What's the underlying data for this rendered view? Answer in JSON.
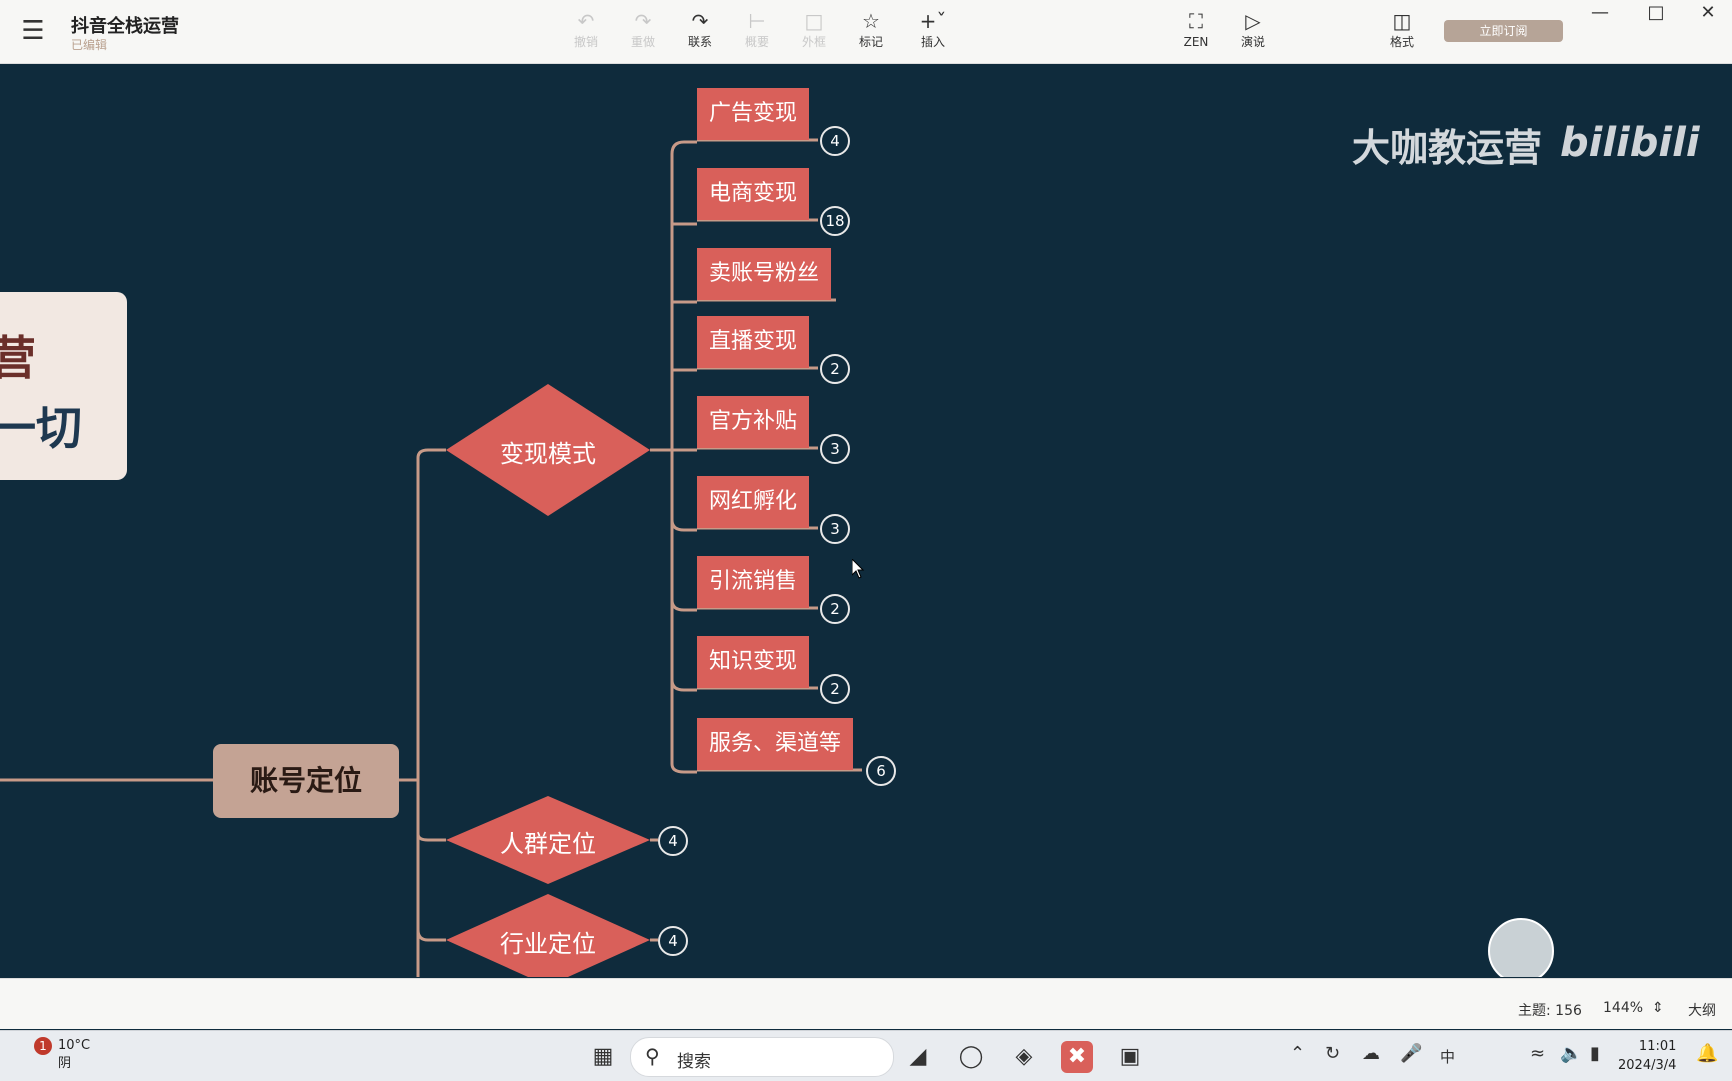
{
  "app": {
    "title": "抖音全栈运营",
    "subtitle": "已编辑",
    "upgrade_label": "立即订阅"
  },
  "toolbar": {
    "undo_label": "撤销",
    "redo_label": "重做",
    "link_label": "联系",
    "summary_label": "概要",
    "boundary_label": "外框",
    "mark_label": "标记",
    "insert_label": "插入",
    "zen_label": "ZEN",
    "present_label": "演说",
    "format_label": "格式"
  },
  "mindmap": {
    "root_line1": "营",
    "root_line2": "一切",
    "center": "账号定位",
    "branches": [
      {
        "label": "变现模式"
      },
      {
        "label": "人群定位",
        "count": "4"
      },
      {
        "label": "行业定位",
        "count": "4"
      }
    ],
    "leaves": [
      {
        "label": "广告变现",
        "count": "4"
      },
      {
        "label": "电商变现",
        "count": "18"
      },
      {
        "label": "卖账号粉丝",
        "count": ""
      },
      {
        "label": "直播变现",
        "count": "2"
      },
      {
        "label": "官方补贴",
        "count": "3"
      },
      {
        "label": "网红孵化",
        "count": "3"
      },
      {
        "label": "引流销售",
        "count": "2"
      },
      {
        "label": "知识变现",
        "count": "2"
      },
      {
        "label": "服务、渠道等",
        "count": "6"
      }
    ]
  },
  "overlay": {
    "watermark": "大咖教运营",
    "bilibili": "bilibili"
  },
  "statusbar": {
    "topics": "主题: 156",
    "zoom": "144%",
    "outline": "大纲"
  },
  "taskbar": {
    "temperature": "10°C",
    "weather": "阴",
    "weather_badge": "1",
    "search_placeholder": "搜索",
    "ime": "中",
    "time": "11:01",
    "date": "2024/3/4"
  },
  "colors": {
    "canvas": "#0f2b3c",
    "leaf": "#d9605a",
    "center": "#c4a394",
    "connector": "#c79a88"
  }
}
